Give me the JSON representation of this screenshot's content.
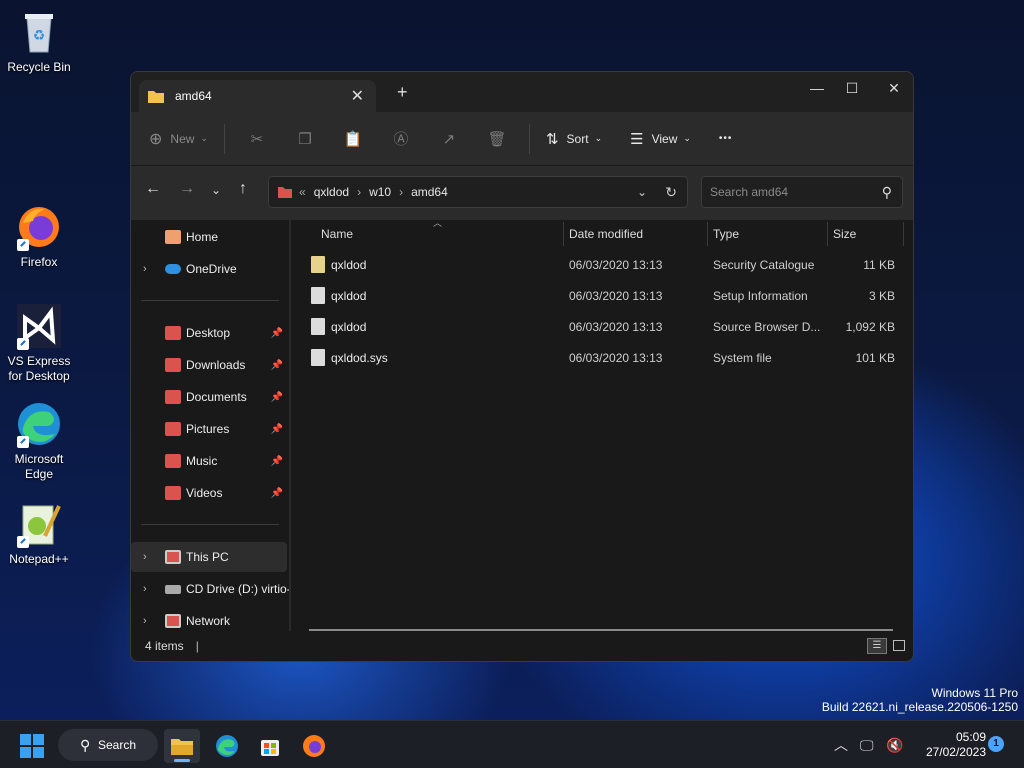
{
  "desktop": {
    "icons": [
      {
        "label": "Recycle Bin",
        "icon": "recycle-bin-icon"
      },
      {
        "label": "Firefox",
        "icon": "firefox-icon"
      },
      {
        "label": "VS Express for Desktop",
        "icon": "visual-studio-icon"
      },
      {
        "label": "Microsoft Edge",
        "icon": "edge-icon"
      },
      {
        "label": "Notepad++",
        "icon": "notepadpp-icon"
      }
    ],
    "watermark": {
      "line1": "Windows 11 Pro",
      "line2": "Build 22621.ni_release.220506-1250"
    }
  },
  "window": {
    "tab_title": "amd64",
    "tab_close": "✕",
    "new_tab": "+",
    "controls": {
      "minimize": "—",
      "maximize": "☐",
      "close": "✕"
    },
    "toolbar": {
      "new_label": "New",
      "sort_label": "Sort",
      "view_label": "View",
      "more_label": "•••"
    },
    "address": {
      "overflow": "«",
      "crumbs": [
        "qxldod",
        "w10",
        "amd64"
      ]
    },
    "search": {
      "placeholder": "Search amd64"
    },
    "sidebar": {
      "home": "Home",
      "onedrive": "OneDrive",
      "quick": [
        "Desktop",
        "Downloads",
        "Documents",
        "Pictures",
        "Music",
        "Videos"
      ],
      "this_pc": "This PC",
      "cd_drive": "CD Drive (D:) virtio-",
      "network": "Network"
    },
    "columns": {
      "name": "Name",
      "date": "Date modified",
      "type": "Type",
      "size": "Size"
    },
    "files": [
      {
        "name": "qxldod",
        "date": "06/03/2020 13:13",
        "type": "Security Catalogue",
        "size": "11 KB"
      },
      {
        "name": "qxldod",
        "date": "06/03/2020 13:13",
        "type": "Setup Information",
        "size": "3 KB"
      },
      {
        "name": "qxldod",
        "date": "06/03/2020 13:13",
        "type": "Source Browser D...",
        "size": "1,092 KB"
      },
      {
        "name": "qxldod.sys",
        "date": "06/03/2020 13:13",
        "type": "System file",
        "size": "101 KB"
      }
    ],
    "status": {
      "items": "4 items"
    }
  },
  "taskbar": {
    "search_label": "Search",
    "time": "05:09",
    "date": "27/02/2023",
    "notification_count": "1"
  },
  "colors": {
    "accent": "#3aa0f0",
    "folder": "#f2c14e",
    "window_bg": "#191919"
  }
}
